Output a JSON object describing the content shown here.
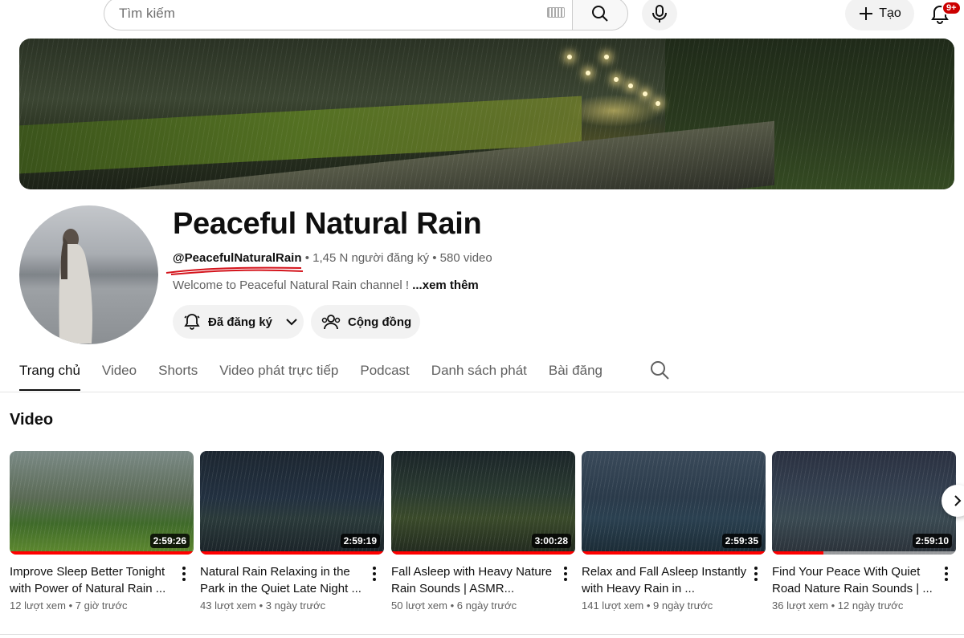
{
  "topbar": {
    "search_placeholder": "Tìm kiếm",
    "create_label": "Tạo",
    "notification_badge": "9+"
  },
  "channel": {
    "name": "Peaceful Natural Rain",
    "handle": "@PeacefulNaturalRain",
    "subscribers": "1,45 N người đăng ký",
    "video_count": "580 video",
    "description": "Welcome to Peaceful Natural Rain channel ! ",
    "more_label": "...xem thêm",
    "subscribed_label": "Đã đăng ký",
    "community_label": "Cộng đồng"
  },
  "tabs": [
    {
      "label": "Trang chủ",
      "active": true
    },
    {
      "label": "Video"
    },
    {
      "label": "Shorts"
    },
    {
      "label": "Video phát trực tiếp"
    },
    {
      "label": "Podcast"
    },
    {
      "label": "Danh sách phát"
    },
    {
      "label": "Bài đăng"
    }
  ],
  "section": {
    "title": "Video"
  },
  "videos": [
    {
      "title": "Improve Sleep Better Tonight with Power of Natural Rain ...",
      "duration": "2:59:26",
      "views": "12 lượt xem",
      "age": "7 giờ trước",
      "watched": 1.0
    },
    {
      "title": "Natural Rain Relaxing in the Park in the Quiet Late Night ...",
      "duration": "2:59:19",
      "views": "43 lượt xem",
      "age": "3 ngày trước",
      "watched": 1.0
    },
    {
      "title": "Fall Asleep with Heavy Nature Rain Sounds | ASMR...",
      "duration": "3:00:28",
      "views": "50 lượt xem",
      "age": "6 ngày trước",
      "watched": 1.0
    },
    {
      "title": "Relax and Fall Asleep Instantly with Heavy Rain in ...",
      "duration": "2:59:35",
      "views": "141 lượt xem",
      "age": "9 ngày trước",
      "watched": 1.0
    },
    {
      "title": "Find Your Peace With Quiet Road Nature Rain Sounds | ...",
      "duration": "2:59:10",
      "views": "36 lượt xem",
      "age": "12 ngày trước",
      "watched": 0.28
    }
  ],
  "colors": {
    "accent": "#ff0000",
    "badge": "#cc0000",
    "annotation": "#d4141c"
  }
}
